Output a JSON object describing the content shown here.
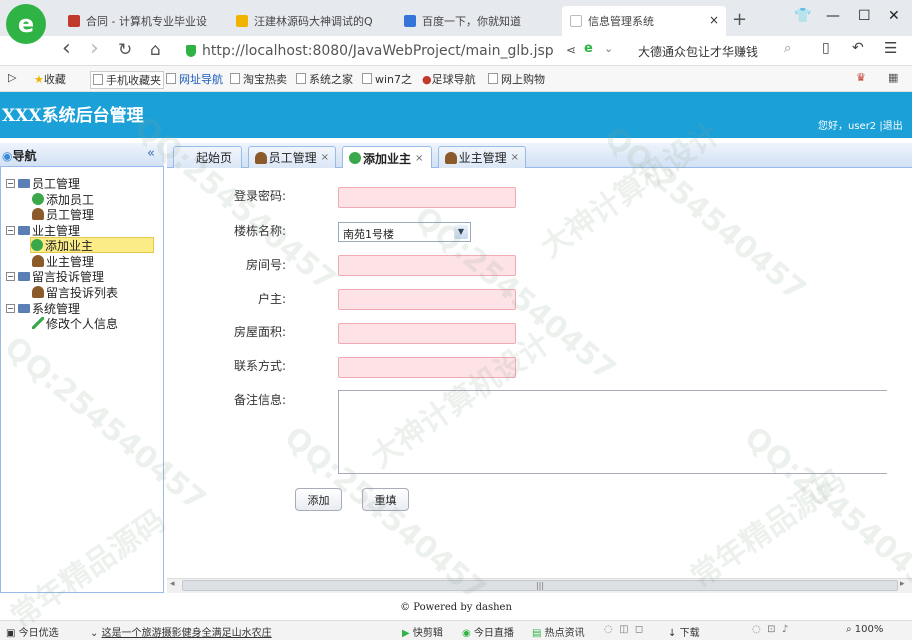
{
  "browser": {
    "tabs": [
      {
        "label": "合同 - 计算机专业毕业设",
        "fav_color": "#c0392b"
      },
      {
        "label": "汪建林源码大神调试的Q",
        "fav_color": "#f0b400"
      },
      {
        "label": "百度一下，你就知道",
        "fav_color": "#3575d9"
      },
      {
        "label": "信息管理系统",
        "fav_color": "#bbbbbb"
      }
    ],
    "close_tab": "×",
    "new_tab": "+",
    "window_controls": [
      "👕",
      "—",
      "☐",
      "✕"
    ],
    "nav": {
      "back": "‹",
      "forward": "›",
      "reload": "↻",
      "home": "⌂"
    },
    "url": "http://localhost:8080/JavaWebProject/main_glb.jsp",
    "promo_text": "大德通众包让才华赚钱",
    "bookmarks": [
      "收藏",
      "手机收藏夹",
      "网址导航",
      "淘宝热卖",
      "系统之家",
      "win7之",
      "足球导航",
      "网上购物"
    ]
  },
  "app": {
    "title": "XXX系统后台管理",
    "greeting": "您好，",
    "username": "user2",
    "separator": "|",
    "logout": "退出"
  },
  "nav": {
    "title": "导航",
    "collapse": "«",
    "tree": [
      {
        "label": "员工管理",
        "children": [
          "添加员工",
          "员工管理"
        ]
      },
      {
        "label": "业主管理",
        "children": [
          "添加业主",
          "业主管理"
        ]
      },
      {
        "label": "留言投诉管理",
        "children": [
          "留言投诉列表"
        ]
      },
      {
        "label": "系统管理",
        "children": [
          "修改个人信息"
        ]
      }
    ],
    "selected": "添加业主"
  },
  "tabs": [
    {
      "label": "起始页",
      "closable": false
    },
    {
      "label": "员工管理",
      "closable": true
    },
    {
      "label": "添加业主",
      "closable": true,
      "active": true
    },
    {
      "label": "业主管理",
      "closable": true
    }
  ],
  "form": {
    "fields": [
      {
        "label": "登录密码:",
        "type": "input",
        "value": ""
      },
      {
        "label": "楼栋名称:",
        "type": "select",
        "value": "南苑1号楼"
      },
      {
        "label": "房间号:",
        "type": "input",
        "value": ""
      },
      {
        "label": "户主:",
        "type": "input",
        "value": ""
      },
      {
        "label": "房屋面积:",
        "type": "input",
        "value": ""
      },
      {
        "label": "联系方式:",
        "type": "input",
        "value": ""
      },
      {
        "label": "备注信息:",
        "type": "textarea",
        "value": ""
      }
    ],
    "submit": "添加",
    "reset": "重填"
  },
  "footer": "© Powered by dashen",
  "status": {
    "left": "今日优选",
    "news": "这是一个旅游摄影健身全满足山水农庄",
    "items": [
      "快剪辑",
      "今日直播",
      "热点资讯"
    ],
    "download": "下载",
    "zoom": "100%"
  },
  "watermark": {
    "qq": "QQ:254540457",
    "tag1": "大神计算机设计",
    "tag2": "常年精品源码"
  }
}
